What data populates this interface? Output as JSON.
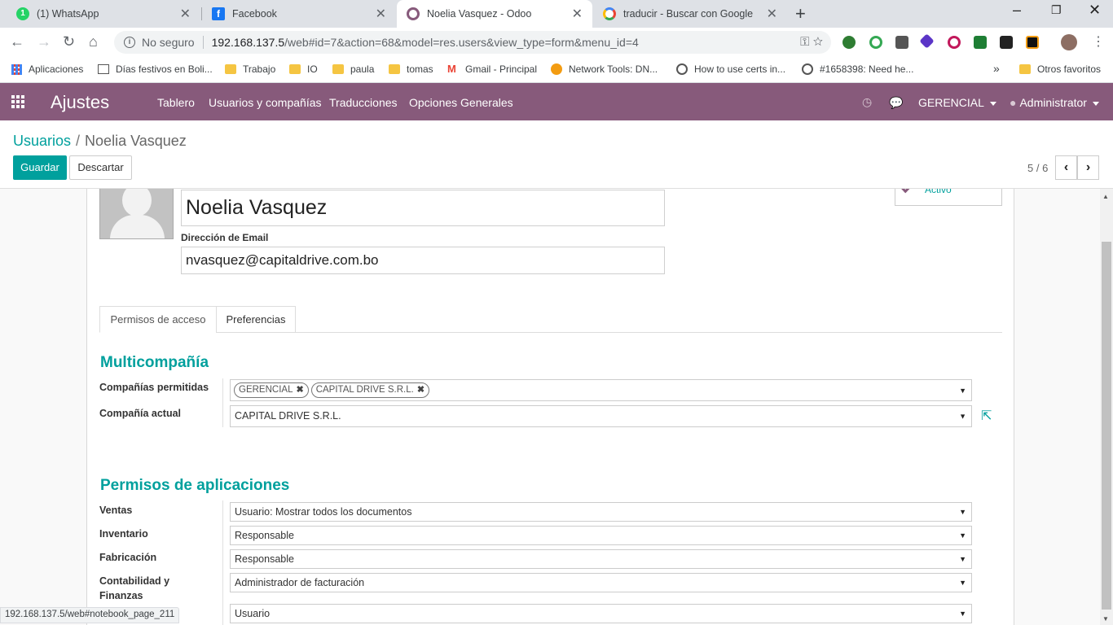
{
  "browser": {
    "tabs": [
      {
        "label": "(1) WhatsApp",
        "color": "#25d366",
        "badge": "1"
      },
      {
        "label": "Facebook",
        "color": "#1877f2"
      },
      {
        "label": "Noelia Vasquez - Odoo",
        "color": "#875a7b"
      },
      {
        "label": "traducir - Buscar con Google",
        "color": "#4285f4"
      }
    ],
    "insecure_label": "No seguro",
    "url_host": "192.168.137.5",
    "url_path": "/web#id=7&action=68&model=res.users&view_type=form&menu_id=4",
    "bookmarks": [
      "Aplicaciones",
      "Días festivos en Boli...",
      "Trabajo",
      "IO",
      "paula",
      "tomas",
      "Gmail - Principal",
      "Network Tools: DN...",
      "How to use certs in...",
      "#1658398: Need he...",
      "Otros favoritos"
    ],
    "more_bookmarks": "»",
    "status_url": "192.168.137.5/web#notebook_page_211"
  },
  "navbar": {
    "brand": "Ajustes",
    "menu": [
      "Tablero",
      "Usuarios y compañías",
      "Traducciones",
      "Opciones Generales"
    ],
    "company": "GERENCIAL",
    "user": "Administrator",
    "color": "#875a7b"
  },
  "control_panel": {
    "breadcrumb_parent": "Usuarios",
    "breadcrumb_separator": "/",
    "breadcrumb_current": "Noelia Vasquez",
    "save_label": "Guardar",
    "discard_label": "Descartar",
    "pager": "5 / 6"
  },
  "form": {
    "name": "Noelia Vasquez",
    "email_label": "Dirección de Email",
    "email": "nvasquez@capitaldrive.com.bo",
    "active_label": "Activo",
    "tabs": [
      "Permisos de acceso",
      "Preferencias"
    ],
    "multicompany": {
      "title": "Multicompañía",
      "allowed_label": "Compañías permitidas",
      "allowed_tags": [
        "GERENCIAL",
        "CAPITAL DRIVE S.R.L."
      ],
      "current_label": "Compañía actual",
      "current_value": "CAPITAL DRIVE S.R.L."
    },
    "app_permissions": {
      "title": "Permisos de aplicaciones",
      "rows": [
        {
          "label": "Ventas",
          "value": "Usuario: Mostrar todos los documentos"
        },
        {
          "label": "Inventario",
          "value": "Responsable"
        },
        {
          "label": "Fabricación",
          "value": "Responsable"
        },
        {
          "label": "Contabilidad y Finanzas",
          "value": "Administrador de facturación"
        },
        {
          "label": "",
          "value": "Usuario"
        }
      ]
    },
    "accent": "#00a09d"
  }
}
